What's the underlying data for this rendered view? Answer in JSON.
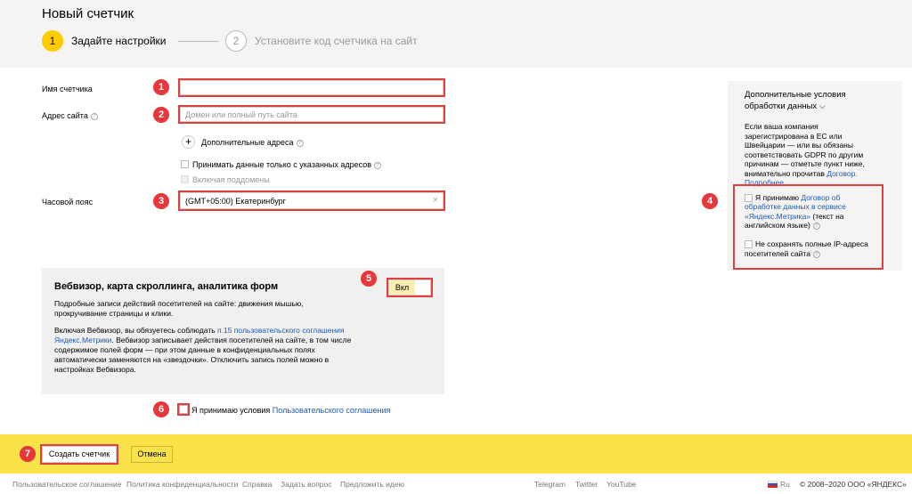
{
  "header": {
    "title": "Новый счетчик",
    "steps": [
      {
        "num": "1",
        "label": "Задайте настройки"
      },
      {
        "num": "2",
        "label": "Установите код счетчика на сайт"
      }
    ]
  },
  "form": {
    "counter_name_label": "Имя счетчика",
    "site_address_label": "Адрес сайта",
    "site_address_placeholder": "Домен или полный путь сайта",
    "additional_addresses": "Дополнительные адреса",
    "only_specified_addresses": "Принимать данные только с указанных адресов",
    "include_subdomains": "Включая поддомены",
    "timezone_label": "Часовой пояс",
    "timezone_value": "(GMT+05:00) Екатеринбург",
    "clear_icon": "×"
  },
  "webvisor": {
    "title": "Вебвизор, карта скроллинга, аналитика форм",
    "p1_line1": "Подробные записи действий посетителей на сайте: движения мышью,",
    "p1_line2": "прокручивание страницы и клики.",
    "p2_line1_pre": "Включая Вебвизор, вы обязуетесь соблюдать ",
    "p2_line1_link": "п.15 пользовательского соглашения",
    "p2_line2_link": "Яндекс.Метрики",
    "p2_line2_post": ". Вебвизор записывает действия посетителей на сайте, в том числе",
    "p2_line3": "содержимое полей форм — при этом данные в конфиденциальных полях",
    "p2_line4": "автоматически заменяются на «звездочки». Отключить запись полей можно в",
    "p2_line5": "настройках Вебвизора.",
    "toggle_label": "Вкл"
  },
  "agreement": {
    "pre": "Я принимаю условия ",
    "link": "Пользовательского соглашения"
  },
  "sidebar": {
    "title_line1": "Дополнительные условия",
    "title_line2": "обработки данных",
    "text_l1": "Если ваша компания",
    "text_l2": "зарегистрирована в ЕС или",
    "text_l3": "Швейцарии — или вы обязаны",
    "text_l4": "соответствовать GDPR по другим",
    "text_l5": "причинам — отметьте пункт ниже,",
    "text_l6_pre": "внимательно прочитав ",
    "text_l6_link": "Договор.",
    "more_link": "Подробнее",
    "accept_pre": "Я принимаю ",
    "accept_link_l1": "Договор об",
    "accept_link_l2": "обработке данных в сервисе",
    "accept_link_l3": "«Яндекс.Метрика»",
    "accept_post_l3": " (текст на",
    "accept_post_l4": "английском языке)",
    "ip_l1": "Не сохранять полные IP-адреса",
    "ip_l2": "посетителей сайта"
  },
  "actions": {
    "create": "Создать счетчик",
    "cancel": "Отмена"
  },
  "badges": [
    "1",
    "2",
    "3",
    "4",
    "5",
    "6",
    "7"
  ],
  "footer": {
    "links": [
      "Пользовательское соглашение",
      "Политика конфиденциальности",
      "Справка",
      "Задать вопрос",
      "Предложить идею"
    ],
    "social": [
      "Telegram",
      "Twitter",
      "YouTube"
    ],
    "lang": "Ru",
    "copyright": "© 2008–2020 ООО «ЯНДЕКС»"
  }
}
